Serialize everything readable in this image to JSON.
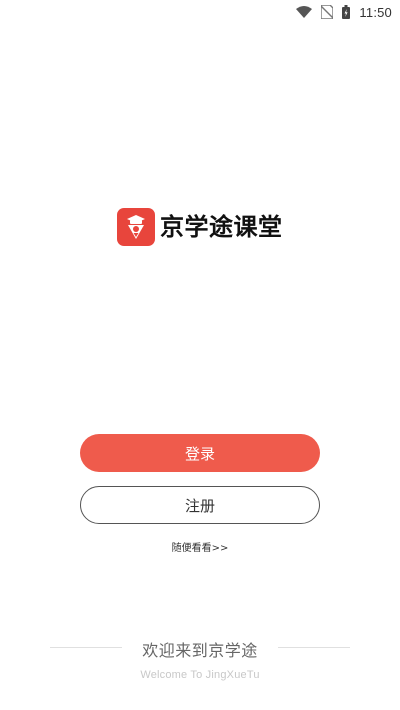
{
  "status_bar": {
    "time": "11:50",
    "icons": [
      "wifi-icon",
      "no-sim-icon",
      "battery-icon"
    ]
  },
  "logo": {
    "icon": "graduate-logo-icon",
    "text": "京学途课堂",
    "brand_color": "#e8453c"
  },
  "actions": {
    "login_label": "登录",
    "register_label": "注册",
    "browse_label": "随便看看>>"
  },
  "footer": {
    "welcome_text": "欢迎来到京学途",
    "welcome_en": "Welcome To JingXueTu"
  },
  "colors": {
    "login_button": "#ef5b4c",
    "register_border": "#555555",
    "background": "#ffffff"
  }
}
